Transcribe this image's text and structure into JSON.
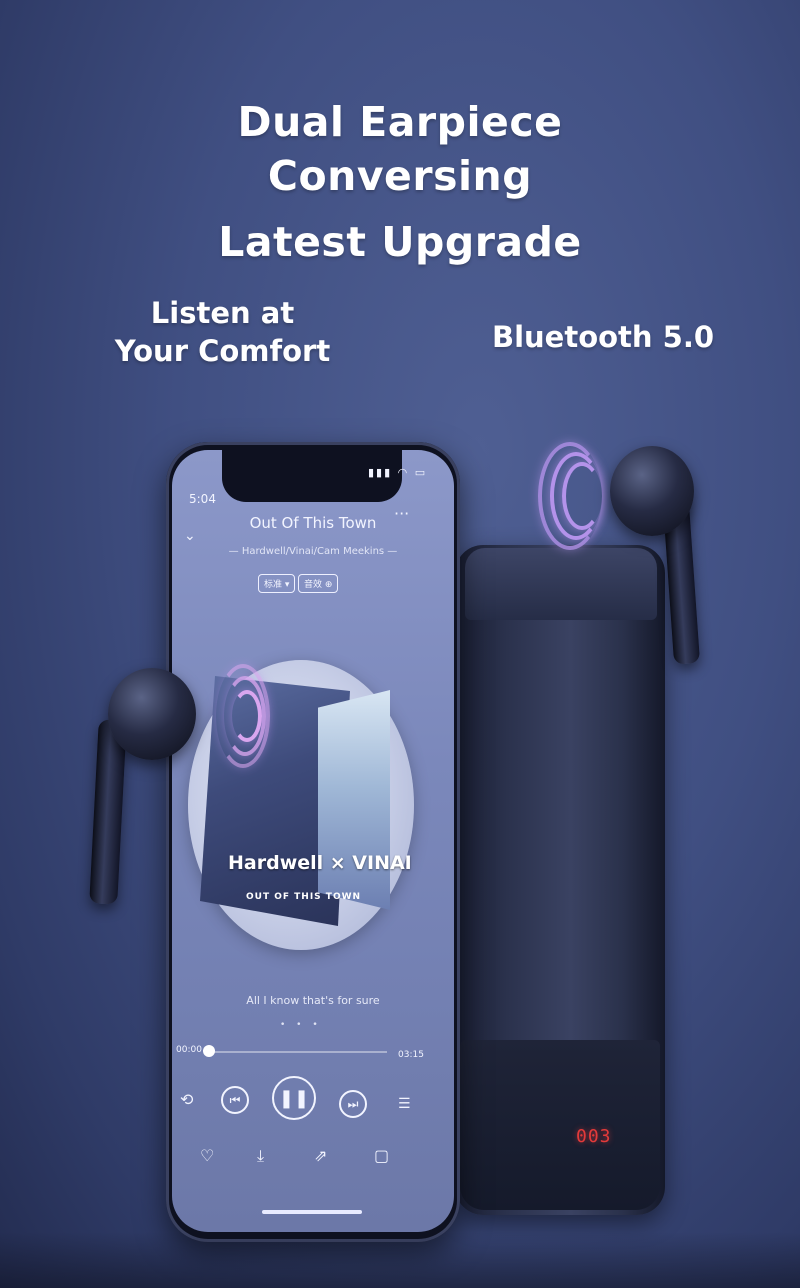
{
  "headline": {
    "line1": "Dual Earpiece",
    "line2": "Conversing",
    "line3": "Latest Upgrade"
  },
  "features": {
    "left_line1": "Listen at",
    "left_line2": "Your Comfort",
    "right": "Bluetooth 5.0"
  },
  "phone": {
    "time": "5:04",
    "status_icons": "▮▮▮ ◠ ▭",
    "song_title": "Out Of This Town",
    "artist": "— Hardwell/Vinai/Cam Meekins —",
    "tag1": "标准 ▾",
    "tag2": "音效 ⊕",
    "album_title": "Hardwell × VINAI",
    "album_sub": "OUT OF THIS TOWN",
    "lyric": "All I know that's for sure",
    "page_dots": "• • •",
    "time_start": "00:00",
    "time_end": "03:15",
    "progress": 0.02,
    "icons": {
      "chevron": "chevron-down-icon",
      "more": "more-dots-icon",
      "loop": "loop-icon",
      "prev": "previous-icon",
      "play": "pause-icon",
      "next": "next-icon",
      "list": "playlist-icon",
      "heart": "heart-icon",
      "download": "download-icon",
      "share": "share-icon",
      "comment": "comment-icon"
    }
  },
  "case": {
    "display": "003"
  },
  "colors": {
    "background": "#404f82",
    "wave_right": "#b493ea",
    "wave_left": "#d9a6ef",
    "display_red": "#e33a3a"
  }
}
